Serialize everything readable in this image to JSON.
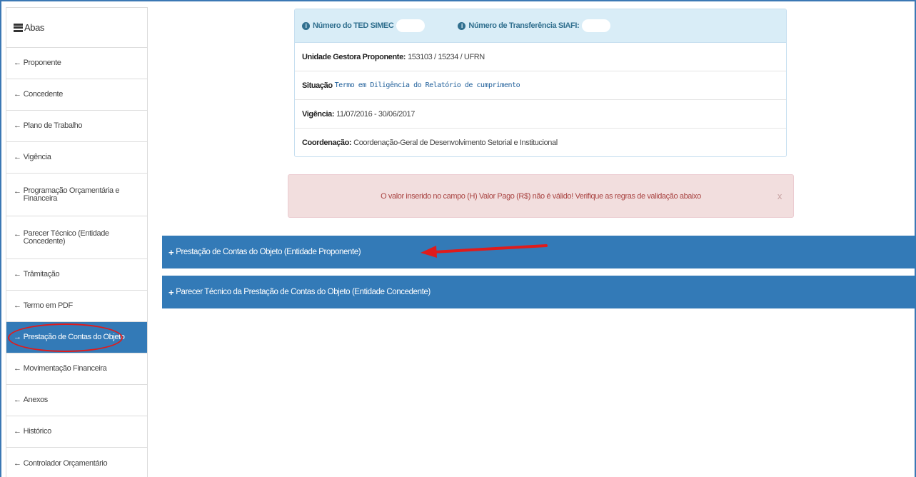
{
  "sidebar": {
    "header": "Abas",
    "items": [
      {
        "icon": "arrow-left-icon",
        "arrow": "←",
        "label": "Proponente"
      },
      {
        "icon": "arrow-left-icon",
        "arrow": "←",
        "label": "Concedente"
      },
      {
        "icon": "arrow-left-icon",
        "arrow": "←",
        "label": "Plano de Trabalho"
      },
      {
        "icon": "arrow-left-icon",
        "arrow": "←",
        "label": "Vigência"
      },
      {
        "icon": "arrow-left-icon",
        "arrow": "←",
        "label": "Programação Orçamentária e Financeira"
      },
      {
        "icon": "arrow-left-icon",
        "arrow": "←",
        "label": "Parecer Técnico (Entidade Concedente)"
      },
      {
        "icon": "arrow-left-icon",
        "arrow": "←",
        "label": "Trâmitação"
      },
      {
        "icon": "arrow-left-icon",
        "arrow": "←",
        "label": "Termo em PDF"
      },
      {
        "icon": "arrow-right-icon",
        "arrow": "→",
        "label": "Prestação de Contas do Objeto",
        "active": true
      },
      {
        "icon": "arrow-left-icon",
        "arrow": "←",
        "label": "Movimentação Financeira"
      },
      {
        "icon": "arrow-left-icon",
        "arrow": "←",
        "label": "Anexos"
      },
      {
        "icon": "arrow-left-icon",
        "arrow": "←",
        "label": "Histórico"
      },
      {
        "icon": "arrow-left-icon",
        "arrow": "←",
        "label": "Controlador Orçamentário"
      }
    ]
  },
  "info": {
    "ted_label": "Número do TED SIMEC",
    "siafi_label": "Número de Transferência SIAFI:",
    "unidade_label": "Unidade Gestora Proponente:",
    "unidade_value": "153103 / 15234 / UFRN",
    "situacao_label": "Situação",
    "situacao_value": "Termo em Diligência do Relatório de cumprimento",
    "vigencia_label": "Vigência:",
    "vigencia_value": "11/07/2016 - 30/06/2017",
    "coordenacao_label": "Coordenação:",
    "coordenacao_value": "Coordenação-Geral de Desenvolvimento Setorial e Institucional"
  },
  "alert": {
    "message": "O valor inserido no campo (H) Valor Pago (R$) não é válido! Verifique as regras de validação abaixo",
    "close": "x"
  },
  "accordion": [
    {
      "label": "Prestação de Contas do Objeto (Entidade Proponente)"
    },
    {
      "label": "Parecer Técnico da Prestação de Contas do Objeto (Entidade Concedente)"
    }
  ],
  "colors": {
    "primary": "#337ab7",
    "info_bg": "#d9edf7",
    "danger_bg": "#f2dede",
    "danger_text": "#a94442",
    "annotation_red": "#e01b1b"
  }
}
